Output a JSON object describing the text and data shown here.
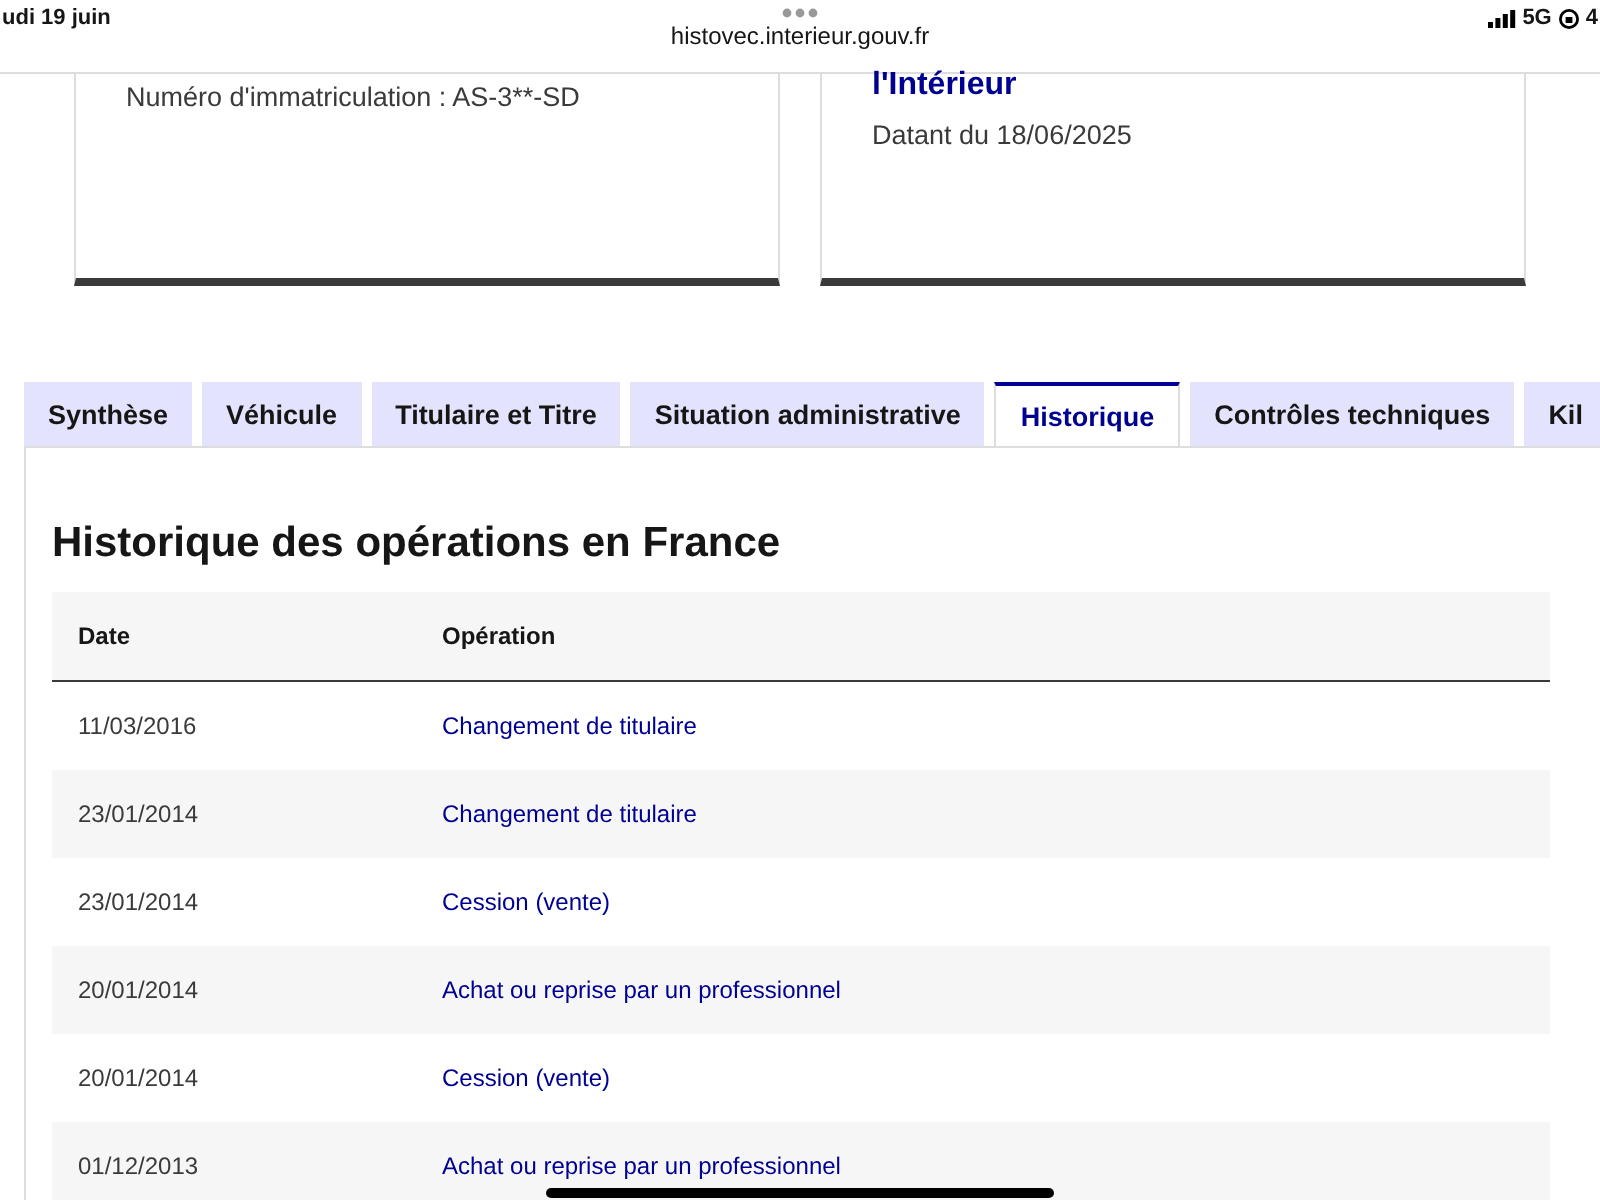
{
  "status_bar": {
    "date": "udi 19 juin",
    "url": "histovec.interieur.gouv.fr",
    "network": "5G",
    "battery": "4"
  },
  "cards": [
    {
      "lines": [
        {
          "kind": "text",
          "text": "Numéro d'immatriculation : AS-3**-SD"
        }
      ]
    },
    {
      "lines": [
        {
          "kind": "title",
          "text": "l'Intérieur"
        },
        {
          "kind": "text",
          "text": "Datant du 18/06/2025"
        }
      ]
    }
  ],
  "tabs": [
    {
      "label": "Synthèse",
      "selected": false
    },
    {
      "label": "Véhicule",
      "selected": false
    },
    {
      "label": "Titulaire et Titre",
      "selected": false
    },
    {
      "label": "Situation administrative",
      "selected": false
    },
    {
      "label": "Historique",
      "selected": true
    },
    {
      "label": "Contrôles techniques",
      "selected": false
    },
    {
      "label": "Kil",
      "selected": false
    }
  ],
  "section": {
    "title": "Historique des opérations en France"
  },
  "table": {
    "columns": [
      "Date",
      "Opération"
    ],
    "rows": [
      [
        "11/03/2016",
        "Changement de titulaire"
      ],
      [
        "23/01/2014",
        "Changement de titulaire"
      ],
      [
        "23/01/2014",
        "Cession (vente)"
      ],
      [
        "20/01/2014",
        "Achat ou reprise par un professionnel"
      ],
      [
        "20/01/2014",
        "Cession (vente)"
      ],
      [
        "01/12/2013",
        "Achat ou reprise par un professionnel"
      ]
    ]
  }
}
